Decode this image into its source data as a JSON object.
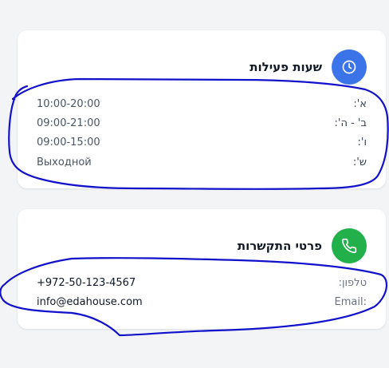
{
  "colors": {
    "hours_icon_bg": "#3b74e9",
    "contact_icon_bg": "#22b04b",
    "annotation_stroke": "#1111cc"
  },
  "hours": {
    "title": "שעות פעילות",
    "icon": "clock-icon",
    "rows": [
      {
        "label": "א':",
        "value": "10:00-20:00"
      },
      {
        "label": "ב' - ה':",
        "value": "09:00-21:00"
      },
      {
        "label": "ו':",
        "value": "09:00-15:00"
      },
      {
        "label": "ש':",
        "value": "Выходной"
      }
    ]
  },
  "contact": {
    "title": "פרטי התקשרות",
    "icon": "phone-icon",
    "rows": [
      {
        "label": "טלפון:",
        "value": "+972-50-123-4567"
      },
      {
        "label": "Email:",
        "value": "info@edahouse.com"
      }
    ]
  }
}
